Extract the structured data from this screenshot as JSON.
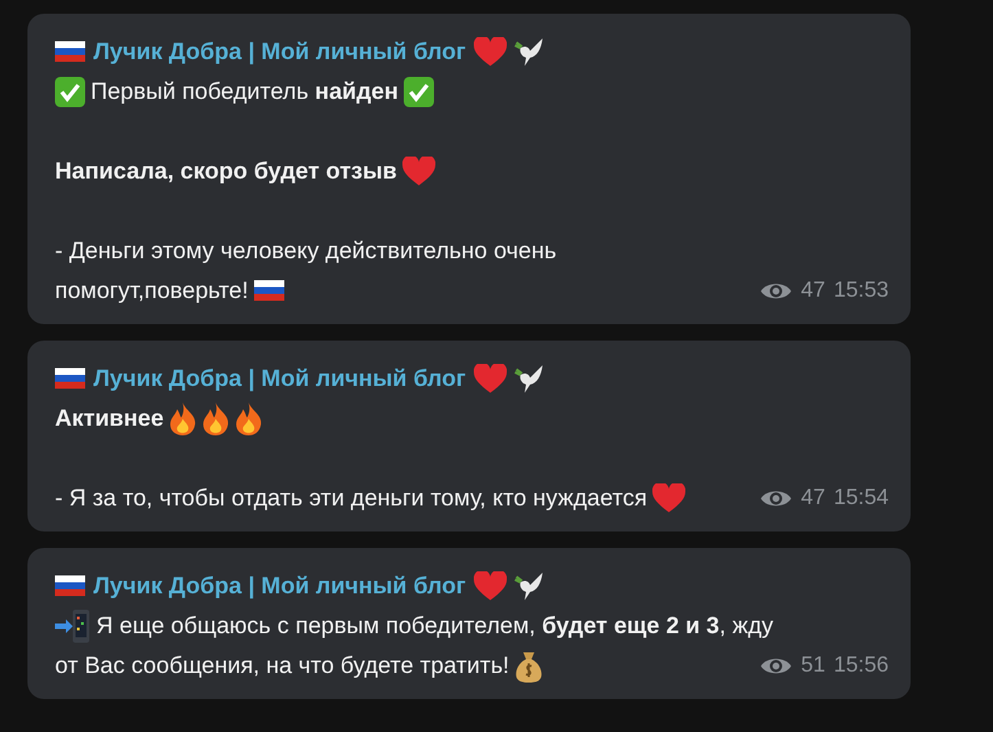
{
  "messages": [
    {
      "title": [
        {
          "kind": "flag"
        },
        {
          "kind": "text",
          "text": "Лучик Добра | Мой личный блог"
        },
        {
          "kind": "heart"
        },
        {
          "kind": "dove"
        }
      ],
      "paragraphs": [
        [
          [
            {
              "kind": "check"
            },
            {
              "kind": "text",
              "text": "Первый победитель **найден**"
            },
            {
              "kind": "check"
            }
          ]
        ],
        [
          [
            {
              "kind": "bold",
              "text": "Написала, скоро будет отзыв"
            },
            {
              "kind": "heart"
            }
          ]
        ],
        [
          [
            {
              "kind": "text",
              "text": "- Деньги этому человеку действительно очень"
            }
          ],
          [
            {
              "kind": "text",
              "text": "помогут,поверьте!"
            },
            {
              "kind": "flag"
            }
          ]
        ]
      ],
      "views": "47",
      "time": "15:53"
    },
    {
      "title": [
        {
          "kind": "flag"
        },
        {
          "kind": "text",
          "text": "Лучик Добра | Мой личный блог"
        },
        {
          "kind": "heart"
        },
        {
          "kind": "dove"
        }
      ],
      "paragraphs": [
        [
          [
            {
              "kind": "bold",
              "text": "Активнее"
            },
            {
              "kind": "fire"
            },
            {
              "kind": "fire"
            },
            {
              "kind": "fire"
            }
          ]
        ],
        [
          [
            {
              "kind": "text",
              "text": "- Я за то, чтобы отдать эти деньги тому, кто нуждается"
            },
            {
              "kind": "heart"
            }
          ]
        ]
      ],
      "views": "47",
      "time": "15:54"
    },
    {
      "title": [
        {
          "kind": "flag"
        },
        {
          "kind": "text",
          "text": "Лучик Добра | Мой личный блог"
        },
        {
          "kind": "heart"
        },
        {
          "kind": "dove"
        }
      ],
      "paragraphs": [
        [
          [
            {
              "kind": "phone"
            },
            {
              "kind": "text",
              "text": "Я еще общаюсь с первым победителем, **будет еще 2 и 3**, жду"
            }
          ],
          [
            {
              "kind": "text",
              "text": "от Вас сообщения, на что будете тратить!"
            },
            {
              "kind": "bag"
            }
          ]
        ]
      ],
      "views": "51",
      "time": "15:56"
    }
  ]
}
